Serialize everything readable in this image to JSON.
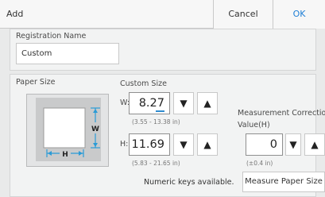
{
  "dialog": {
    "title": "Add",
    "cancel_label": "Cancel",
    "ok_label": "OK"
  },
  "registration": {
    "label": "Registration Name",
    "value": "Custom"
  },
  "paper_size": {
    "label": "Paper Size",
    "custom_size_label": "Custom Size",
    "diagram": {
      "w_label": "W",
      "h_label": "H"
    },
    "width": {
      "label": "W:",
      "value": "8.27",
      "range": "(3.55 - 13.38 in)"
    },
    "height": {
      "label": "H:",
      "value": "11.69",
      "range": "(5.83 - 21.65 in)"
    },
    "numeric_keys_note": "Numeric keys available."
  },
  "measurement_correction": {
    "label": "Measurement Correction",
    "value_label": "Value(H)",
    "value": "0",
    "range": "(±0.4 in)"
  },
  "measure_button_label": "Measure Paper Size",
  "icons": {
    "decrement": "down-triangle-icon",
    "increment": "up-triangle-icon"
  }
}
